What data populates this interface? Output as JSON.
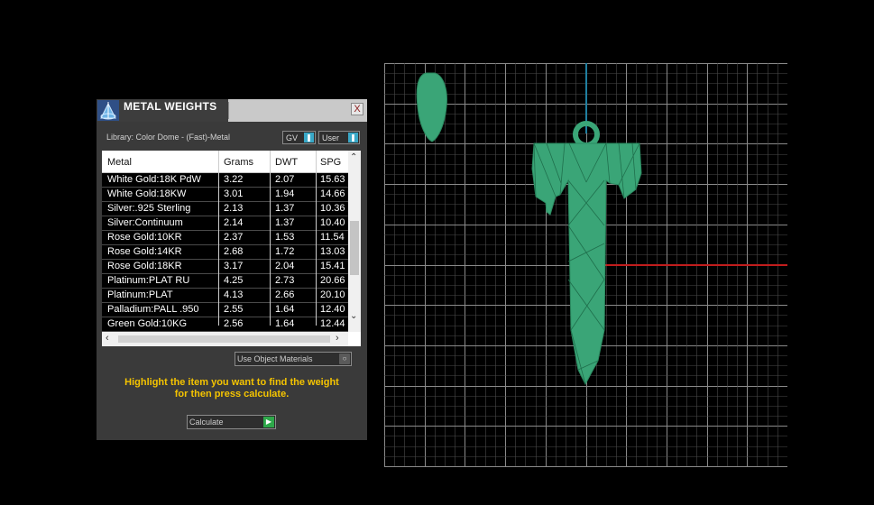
{
  "panel": {
    "title": "METAL WEIGHTS",
    "close_label": "X",
    "library": "Library: Color Dome - (Fast)-Metal",
    "gv_label": "GV",
    "user_label": "User",
    "toggle_icon": "pause-icon"
  },
  "table": {
    "headers": [
      "Metal",
      "Grams",
      "DWT",
      "SPG"
    ],
    "rows": [
      [
        "White Gold:18K PdW",
        "3.22",
        "2.07",
        "15.63"
      ],
      [
        "White Gold:18KW",
        "3.01",
        "1.94",
        "14.66"
      ],
      [
        "Silver:.925 Sterling",
        "2.13",
        "1.37",
        "10.36"
      ],
      [
        "Silver:Continuum",
        "2.14",
        "1.37",
        "10.40"
      ],
      [
        "Rose Gold:10KR",
        "2.37",
        "1.53",
        "11.54"
      ],
      [
        "Rose Gold:14KR",
        "2.68",
        "1.72",
        "13.03"
      ],
      [
        "Rose Gold:18KR",
        "3.17",
        "2.04",
        "15.41"
      ],
      [
        "Platinum:PLAT RU",
        "4.25",
        "2.73",
        "20.66"
      ],
      [
        "Platinum:PLAT",
        "4.13",
        "2.66",
        "20.10"
      ],
      [
        "Palladium:PALL .950",
        "2.55",
        "1.64",
        "12.40"
      ],
      [
        "Green Gold:10KG",
        "2.56",
        "1.64",
        "12.44"
      ]
    ]
  },
  "use_object_label": "Use Object Materials",
  "instruction": [
    "Highlight the item you want to find the weight",
    "for then press calculate."
  ],
  "calculate_label": "Calculate",
  "colors": {
    "accent_yellow": "#f5c400",
    "model_green": "#3aa577",
    "axis_blue": "#1f7fa0",
    "axis_red": "#c21d1d",
    "grid": "#5c5c5c"
  }
}
